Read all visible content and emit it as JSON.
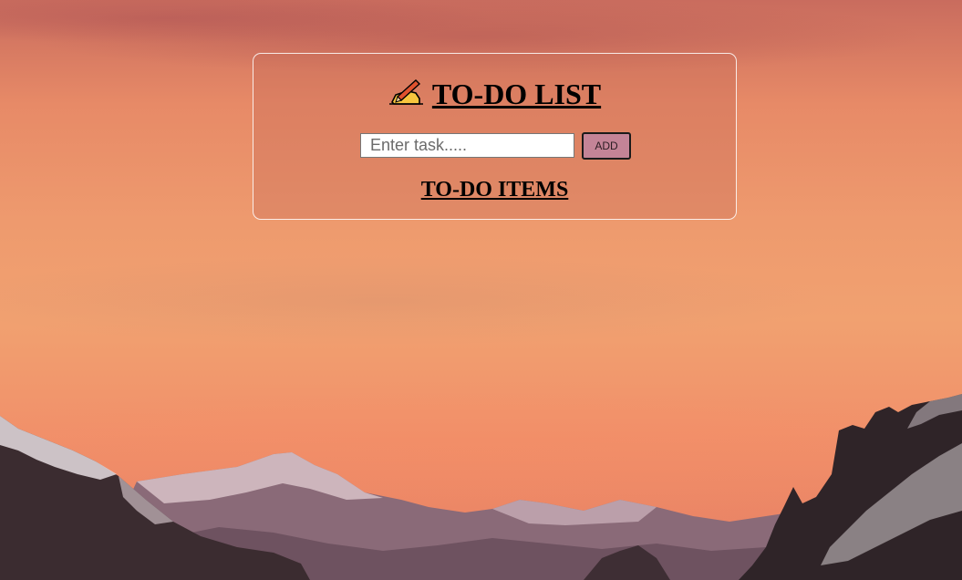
{
  "app": {
    "title": "TO-DO LIST",
    "title_icon": "writing-hand-icon"
  },
  "form": {
    "input_value": "",
    "input_placeholder": "Enter task.....",
    "add_label": "ADD"
  },
  "list": {
    "heading": "TO-DO ITEMS",
    "items": []
  },
  "colors": {
    "add_button": "#c48497",
    "card_border": "#ffffff"
  }
}
